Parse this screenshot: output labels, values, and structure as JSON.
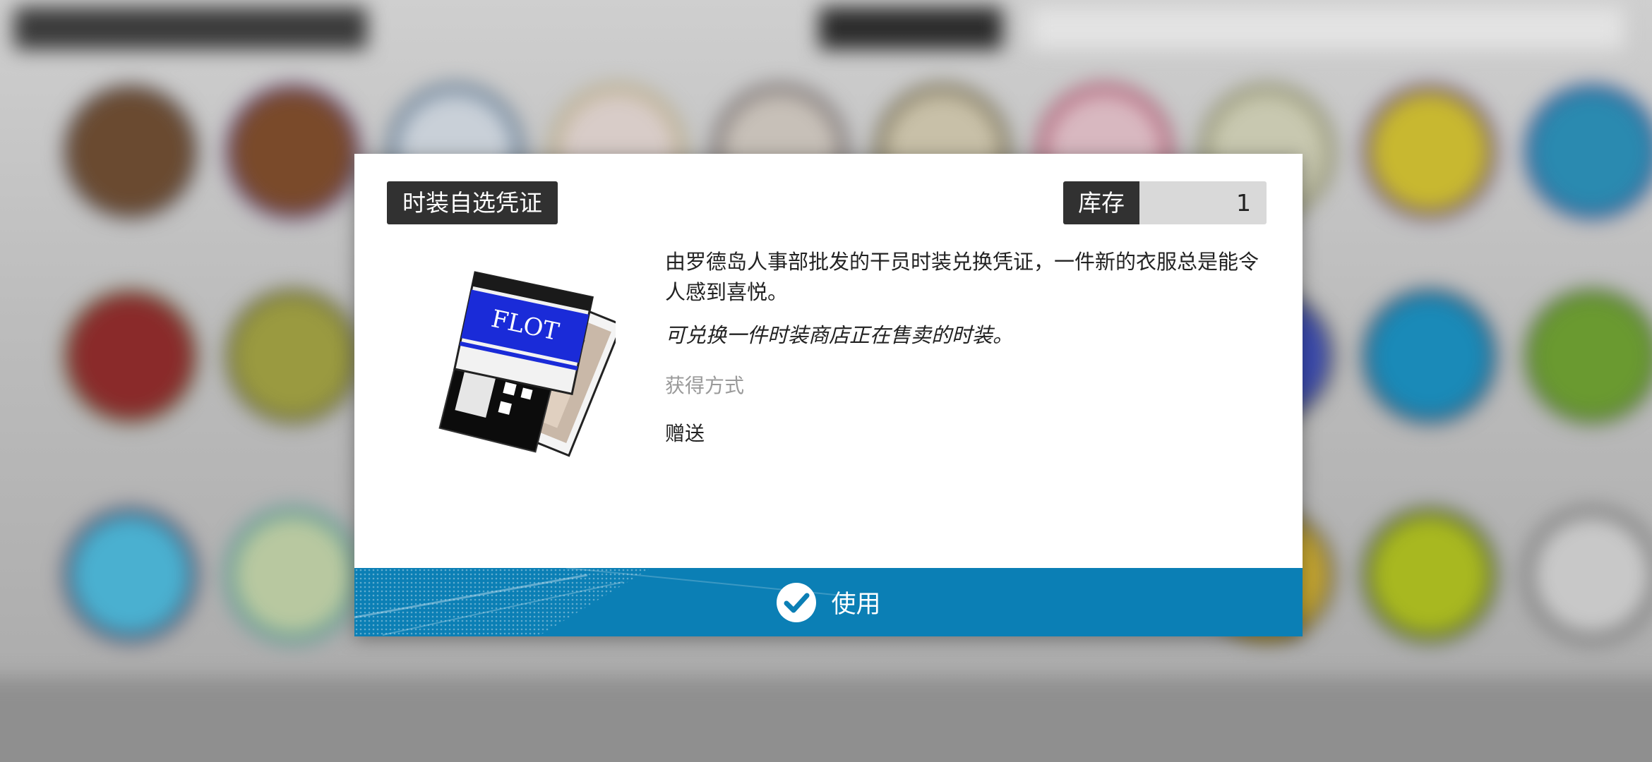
{
  "item": {
    "title": "时装自选凭证",
    "stock_label": "库存",
    "stock_value": "1",
    "description": "由罗德岛人事部批发的干员时装兑换凭证，一件新的衣服总是能令人感到喜悦。",
    "usage": "可兑换一件时装商店正在售卖的时装。",
    "obtain_label": "获得方式",
    "obtain_value": "赠送",
    "art_text": "FLOT"
  },
  "actions": {
    "use_label": "使用"
  },
  "colors": {
    "accent": "#0b7fb5",
    "title_bg": "#313131",
    "stock_bg": "#d9d9d9",
    "muted_text": "#9a9a9a"
  },
  "icons": {
    "use": "check-circle-icon",
    "item": "fashion-voucher-icon"
  }
}
